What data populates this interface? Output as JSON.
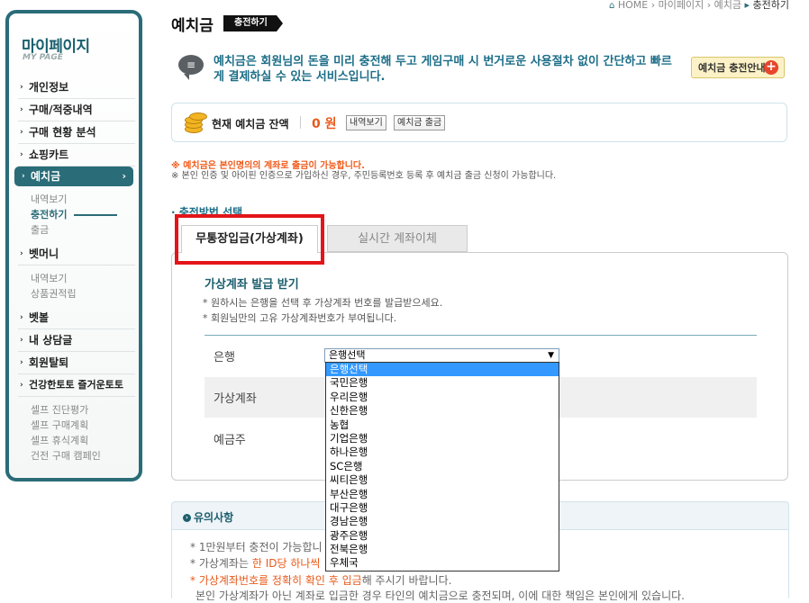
{
  "breadcrumb": {
    "home": "HOME",
    "sep": "›",
    "mypage": "마이페이지",
    "deposit": "예치금",
    "current": "충전하기"
  },
  "sidebar": {
    "title": "마이페이지",
    "subtitle": "MY PAGE",
    "items": [
      {
        "label": "개인정보"
      },
      {
        "label": "구매/적중내역"
      },
      {
        "label": "구매 현황 분석"
      },
      {
        "label": "쇼핑카트"
      },
      {
        "label": "예치금"
      }
    ],
    "deposit_sub": [
      "내역보기",
      "충전하기",
      "출금"
    ],
    "betmoney": "벳머니",
    "betmoney_sub": [
      "내역보기",
      "상품권적립"
    ],
    "items2": [
      {
        "label": "벳볼"
      },
      {
        "label": "내 상담글"
      },
      {
        "label": "회원탈퇴"
      },
      {
        "label": "건강한토토 즐거운토토"
      }
    ],
    "health_sub": [
      "셀프 진단평가",
      "셀프 구매계획",
      "셀프 휴식계획",
      "건전 구매 캠페인"
    ]
  },
  "header": {
    "title": "예치금",
    "tag": "충전하기"
  },
  "intro": {
    "text": "예치금은 회원님의 돈을 미리 충전해 두고 게임구매 시 번거로운 사용절차 없이 간단하고 빠르게 결제하실 수 있는 서비스입니다.",
    "guide_button": "예치금 충전안내"
  },
  "balance": {
    "label": "현재 예치금 잔액",
    "amount": "0 원",
    "history_button": "내역보기",
    "withdraw_button": "예치금 출금"
  },
  "notices": {
    "line1": "※ 예치금은 본인명의의 계좌로 출금이 가능합니다.",
    "line2": "※ 본인 인증 및 아이핀 인증으로 가입하신 경우, 주민등록번호 등록 후 예치금 출금 신청이 가능합니다."
  },
  "section_title": "충전방법 선택",
  "tabs": [
    "무통장입금(가상계좌)",
    "실시간 계좌이체"
  ],
  "form": {
    "title": "가상계좌 발급 받기",
    "desc1": "* 원하시는 은행을 선택 후 가상계좌 번호를 발급받으세요.",
    "desc2": "* 회원님만의 고유 가상계좌번호가 부여됩니다.",
    "labels": [
      "은행",
      "가상계좌",
      "예금주"
    ],
    "bank_selected": "은행선택",
    "bank_options": [
      "은행선택",
      "국민은행",
      "우리은행",
      "신한은행",
      "농협",
      "기업은행",
      "하나은행",
      "SC은행",
      "씨티은행",
      "부산은행",
      "대구은행",
      "경남은행",
      "광주은행",
      "전북은행",
      "우체국"
    ]
  },
  "notes": {
    "title": "유의사항",
    "line1": "* 1만원부터 충전이 가능합니",
    "line2_prefix": "* 가상계좌는 ",
    "line2_orange": "한 ID당 하나씩",
    "line3_orange": "* 가상계좌번호를 정확히 확인 후 입금",
    "line3_suffix": "해 주시기 바랍니다.",
    "line4": "본인 가상계좌가 아닌 계좌로 입금한 경우 타인의 예치금으로 충전되며, 이에 대한 책임은 본인에게 있습니다."
  }
}
